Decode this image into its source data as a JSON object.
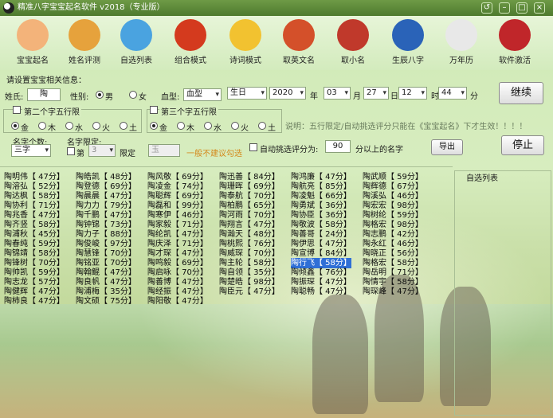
{
  "title": "精准八字宝宝起名软件 v2018（专业版）",
  "toolbar": [
    {
      "label": "宝宝起名",
      "icon": "baby-face-icon",
      "color": "#f3b37a"
    },
    {
      "label": "姓名评测",
      "icon": "tiger-icon",
      "color": "#e6a23c"
    },
    {
      "label": "自选列表",
      "icon": "bird-icon",
      "color": "#4aa3e0"
    },
    {
      "label": "组合模式",
      "icon": "lantern-icon",
      "color": "#d43a1e"
    },
    {
      "label": "诗词模式",
      "icon": "book-icon",
      "color": "#f2c230"
    },
    {
      "label": "取英文名",
      "icon": "mask-icon",
      "color": "#d4502a"
    },
    {
      "label": "取小名",
      "icon": "monkey-icon",
      "color": "#c0392b"
    },
    {
      "label": "生辰八字",
      "icon": "yin-yang-icon",
      "color": "#2a63b8"
    },
    {
      "label": "万年历",
      "icon": "calendar-icon",
      "color": "#e8e8e8"
    },
    {
      "label": "软件激活",
      "icon": "lock-icon",
      "color": "#c0262a"
    }
  ],
  "settings_title": "请设置宝宝相关信息：",
  "form": {
    "surname_label": "姓氏:",
    "surname_value": "陶",
    "gender_label": "性别:",
    "gender_male": "男",
    "gender_female": "女",
    "blood_label": "血型:",
    "blood_value": "血型",
    "date_type": "生日",
    "year_value": "2020",
    "year_unit": "年",
    "month_value": "03",
    "month_unit": "月",
    "day_value": "27",
    "day_unit": "日",
    "hour_value": "12",
    "hour_unit": "时",
    "minute_value": "44",
    "minute_unit": "分"
  },
  "continue_button": "继续",
  "group2": {
    "title": "第二个字五行限",
    "options": [
      "金",
      "木",
      "水",
      "火",
      "土"
    ]
  },
  "group3": {
    "title": "第三个字五行限",
    "options": [
      "金",
      "木",
      "水",
      "火",
      "土"
    ]
  },
  "note": "说明：五行限定/自动挑选评分只能在《宝宝起名》下才生效！！！！",
  "name_count_label": "名字个数:",
  "name_count_value": "三字",
  "limit_label": "名字限定:",
  "limit_pos_label": "第",
  "limit_pos_value": "3",
  "limit_suffix": "限定",
  "limit_char_value": "玉",
  "limit_hint": "一般不建议勾选",
  "auto_score_label": "自动挑选评分为:",
  "auto_score_value": "90",
  "auto_score_suffix": "分以上的名字",
  "export_button": "导出",
  "stop_button": "停止",
  "favorites_label": "自选列表",
  "results": [
    [
      "陶明伟【 47分】",
      "陶皓凯【 48分】",
      "陶风敬【 69分】",
      "陶迅善【 84分】",
      "陶鸿廉【 47分】",
      "陶武顺【 59分】"
    ],
    [
      "陶溶弘【 52分】",
      "陶登德【 69分】",
      "陶凌金【 74分】",
      "陶珊晖【 69分】",
      "陶航亮【 85分】",
      "陶辉德【 67分】"
    ],
    [
      "陶达枫【 58分】",
      "陶晨晨【 47分】",
      "陶聪辉【 69分】",
      "陶泰航【 70分】",
      "陶凌魁【 66分】",
      "陶溪弘【 46分】"
    ],
    [
      "陶协利【 71分】",
      "陶力力【 79分】",
      "陶磊和【 99分】",
      "陶柏鹏【 65分】",
      "陶勇斌【 36分】",
      "陶宏宏【 98分】"
    ],
    [
      "陶兆香【 47分】",
      "陶千鹏【 47分】",
      "陶寒伊【 46分】",
      "陶河雨【 70分】",
      "陶协臣【 36分】",
      "陶树纶【 59分】"
    ],
    [
      "陶齐竖【 58分】",
      "陶钟锦【 73分】",
      "陶家毅【 71分】",
      "陶翔言【 47分】",
      "陶敬波【 58分】",
      "陶格宏【 98分】"
    ],
    [
      "陶浦秋【 45分】",
      "陶力子【 88分】",
      "陶纶凯【 47分】",
      "陶瀚天【 48分】",
      "陶善哥【 24分】",
      "陶志鹏【 42分】"
    ],
    [
      "陶春纯【 59分】",
      "陶俊峻【 97分】",
      "陶庆泽【 71分】",
      "陶桃熙【 76分】",
      "陶伊思【 47分】",
      "陶永红【 46分】"
    ],
    [
      "陶锦靖【 58分】",
      "陶慧锋【 70分】",
      "陶才琛【 47分】",
      "陶威琛【 70分】",
      "陶宣博【 84分】",
      "陶晓正【 56分】"
    ],
    [
      "陶锋树【 70分】",
      "陶铭亚【 70分】",
      "陶鸣毅【 69分】",
      "陶主轮【 58分】",
      "陶行飞【 58分】",
      "陶格宏【 58分】"
    ],
    [
      "陶帅凯【 59分】",
      "陶翰鲲【 47分】",
      "陶启咏【 70分】",
      "陶自领【 35分】",
      "陶倾鑫【 76分】",
      "陶岳明【 71分】"
    ],
    [
      "陶志龙【 57分】",
      "陶良帆【 47分】",
      "陶善博【 47分】",
      "陶楚皓【 98分】",
      "陶振琛【 47分】",
      "陶情宇【 58分】"
    ],
    [
      "陶健辉【 47分】",
      "陶浦梅【 35分】",
      "陶经振【 47分】",
      "陶臣元【 47分】",
      "陶聪畅【 47分】",
      "陶琛峰【 47分】"
    ],
    [
      "陶柿良【 47分】",
      "陶文硕【 75分】",
      "陶阳敬【 47分】",
      "",
      "",
      ""
    ]
  ],
  "highlight": {
    "row": 9,
    "col": 4
  }
}
